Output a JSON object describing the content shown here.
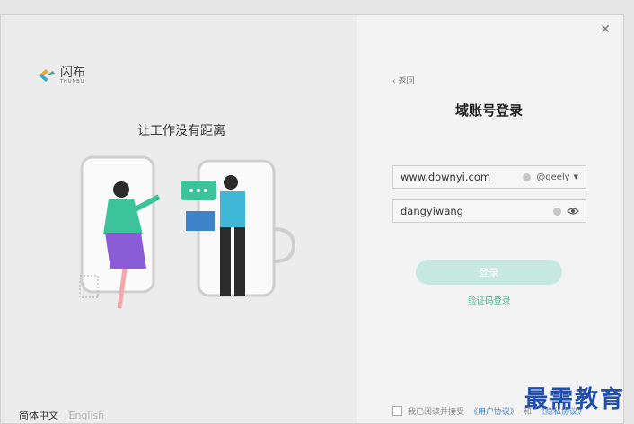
{
  "window": {
    "close_icon": "close-icon"
  },
  "left_panel": {
    "brand_name": "闪布",
    "brand_sub": "THUNBU",
    "slogan": "让工作没有距离",
    "lang_zh": "简体中文",
    "lang_en": "English"
  },
  "right_panel": {
    "back_label": "返回",
    "title": "域账号登录",
    "account_value": "www.downyi.com",
    "domain_value": "@geely",
    "password_value": "dangyiwang",
    "login_label": "登录",
    "code_login_label": "验证码登录",
    "agree_prefix": "我已阅读并接受",
    "agree_user": "《用户协议》",
    "agree_and": "和",
    "agree_privacy": "《隐私协议》"
  },
  "watermark": "最需教育",
  "colors": {
    "accent": "#4cae8f",
    "button_disabled": "#c7e8de",
    "link": "#3f83c9"
  }
}
